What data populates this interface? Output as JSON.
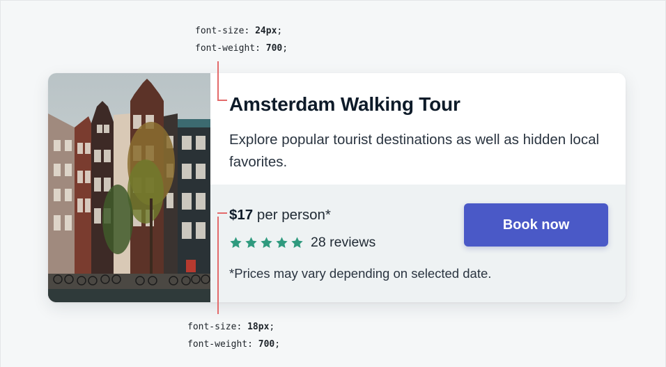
{
  "annotations": {
    "top": {
      "line1_prop": "font-size: ",
      "line1_val": "24px",
      "line1_end": ";",
      "line2_prop": "font-weight: ",
      "line2_val": "700",
      "line2_end": ";"
    },
    "bottom": {
      "line1_prop": "font-size: ",
      "line1_val": "18px",
      "line1_end": ";",
      "line2_prop": "font-weight: ",
      "line2_val": "700",
      "line2_end": ";"
    }
  },
  "card": {
    "title": "Amsterdam Walking Tour",
    "description": "Explore popular tourist destinations as well as hidden local favorites.",
    "price_amount": "$17",
    "price_suffix": " per person*",
    "stars": 5,
    "reviews": "28 reviews",
    "note": "*Prices may vary depending on selected date.",
    "book_label": "Book now",
    "image_icon": "amsterdam-canal-houses-photo"
  },
  "colors": {
    "accent": "#4a59c7",
    "star": "#2f9a7e",
    "annotation_line": "#e36a6a",
    "footer_bg": "#eef2f3"
  }
}
